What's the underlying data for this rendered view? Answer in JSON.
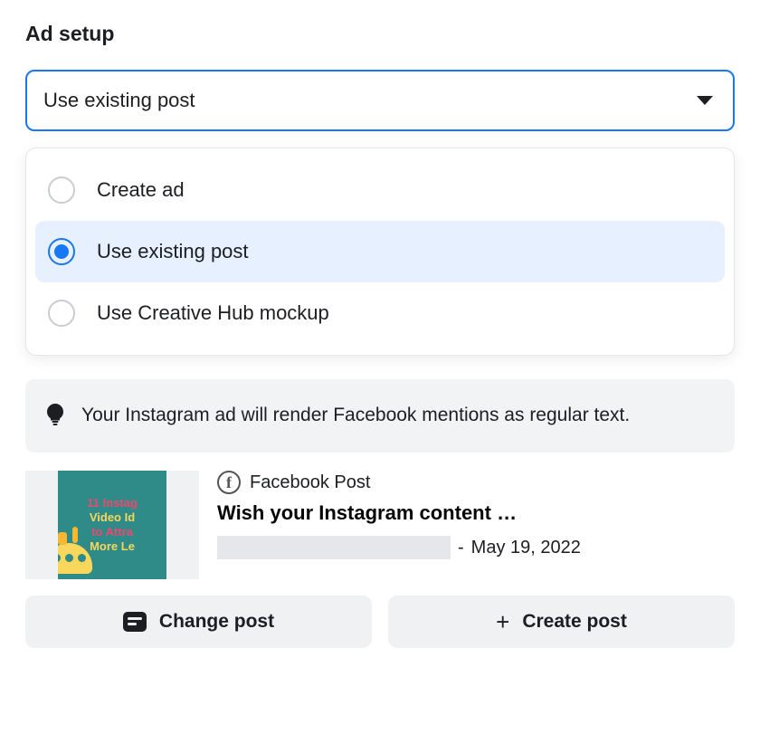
{
  "section_title": "Ad setup",
  "dropdown": {
    "selected": "Use existing post",
    "options": [
      "Create ad",
      "Use existing post",
      "Use Creative Hub mockup"
    ],
    "selected_index": 1
  },
  "notice": "Your Instagram ad will render Facebook mentions as regular text.",
  "post": {
    "platform": "Facebook Post",
    "title": "Wish your Instagram content …",
    "date_prefix": "- ",
    "date": "May 19, 2022",
    "thumbnail_lines": [
      "11 Instag",
      "Video Id",
      "to Attra",
      "More Le"
    ]
  },
  "buttons": {
    "change": "Change post",
    "create": "Create post"
  }
}
